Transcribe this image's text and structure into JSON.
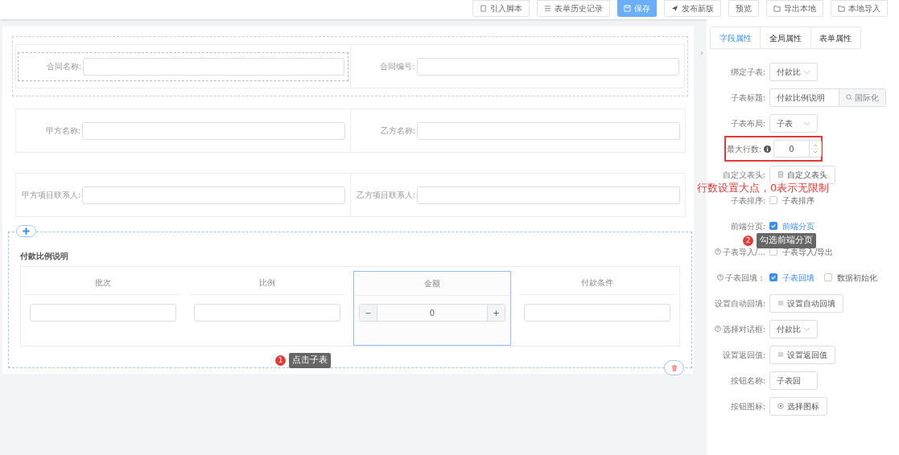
{
  "toolbar": [
    {
      "label": "引入脚本",
      "primary": false
    },
    {
      "label": "表单历史记录",
      "primary": false
    },
    {
      "label": "保存",
      "primary": true
    },
    {
      "label": "发布新版",
      "primary": false
    },
    {
      "label": "预览",
      "primary": false
    },
    {
      "label": "导出本地",
      "primary": false
    },
    {
      "label": "本地导入",
      "primary": false
    }
  ],
  "form_rows": [
    {
      "selected": true,
      "fields": [
        {
          "label": "合同名称:",
          "selected": true
        },
        {
          "label": "合同编号:",
          "selected": false
        }
      ]
    },
    {
      "selected": false,
      "fields": [
        {
          "label": "甲方名称:",
          "selected": false
        },
        {
          "label": "乙方名称:",
          "selected": false
        }
      ]
    },
    {
      "selected": false,
      "fields": [
        {
          "label": "甲方项目联系人:",
          "selected": false
        },
        {
          "label": "乙方项目联系人:",
          "selected": false
        }
      ]
    }
  ],
  "subtable": {
    "title": "付款比例说明",
    "columns": [
      {
        "header": "批次",
        "kind": "text",
        "selected": false
      },
      {
        "header": "比例",
        "kind": "text",
        "selected": false
      },
      {
        "header": "金额",
        "kind": "number",
        "selected": true,
        "value": "0",
        "minus": "−",
        "plus": "+"
      },
      {
        "header": "付款条件",
        "kind": "text",
        "selected": false
      }
    ]
  },
  "tabs": [
    {
      "label": "字段属性",
      "selected": true
    },
    {
      "label": "全局属性",
      "selected": false
    },
    {
      "label": "表单属性",
      "selected": false
    }
  ],
  "properties": [
    {
      "label": "绑定子表:",
      "help": false,
      "highlighted": false,
      "kind": "select",
      "value": "付款比"
    },
    {
      "label": "子表标题:",
      "help": false,
      "highlighted": false,
      "kind": "input-addon",
      "value": "付款比例说明",
      "addon": "国际化"
    },
    {
      "label": "子表布局:",
      "help": false,
      "highlighted": false,
      "kind": "select",
      "value": "子表"
    },
    {
      "label": "最大行数:",
      "help": false,
      "highlighted": true,
      "kind": "number",
      "value": "0"
    },
    {
      "label": "自定义表头:",
      "help": false,
      "highlighted": false,
      "kind": "button",
      "value": "自定义表头"
    },
    {
      "label": "子表排序:",
      "help": false,
      "highlighted": false,
      "kind": "checks",
      "options": [
        {
          "label": "子表排序",
          "checked": false
        }
      ]
    },
    {
      "label": "前端分页:",
      "help": false,
      "highlighted": false,
      "kind": "checks",
      "options": [
        {
          "label": "前端分页",
          "checked": true
        }
      ]
    },
    {
      "label": "子表导入/...",
      "help": true,
      "highlighted": false,
      "kind": "checks",
      "options": [
        {
          "label": "子表导入/导出",
          "checked": false
        }
      ]
    },
    {
      "label": "子表回填：",
      "help": true,
      "highlighted": false,
      "kind": "checks",
      "options": [
        {
          "label": "子表回填",
          "checked": true
        },
        {
          "label": "数据初始化",
          "checked": false
        }
      ]
    },
    {
      "label": "设置自动回填:",
      "help": false,
      "highlighted": false,
      "kind": "button",
      "value": "设置自动回填"
    },
    {
      "label": "选择对话框:",
      "help": true,
      "highlighted": false,
      "kind": "select",
      "value": "付款比"
    },
    {
      "label": "设置返回值:",
      "help": false,
      "highlighted": false,
      "kind": "button",
      "value": "设置返回值"
    },
    {
      "label": "按钮名称:",
      "help": false,
      "highlighted": false,
      "kind": "text-input",
      "value": "子表回"
    },
    {
      "label": "按钮图标:",
      "help": false,
      "highlighted": false,
      "kind": "button",
      "value": "选择图标"
    }
  ],
  "annotations": [
    {
      "number": "1",
      "text": "点击子表"
    },
    {
      "number": "2",
      "text": "勾选前端分页"
    }
  ],
  "callout": "行数设置大点，0表示无限制",
  "collapse_arrow": "›"
}
